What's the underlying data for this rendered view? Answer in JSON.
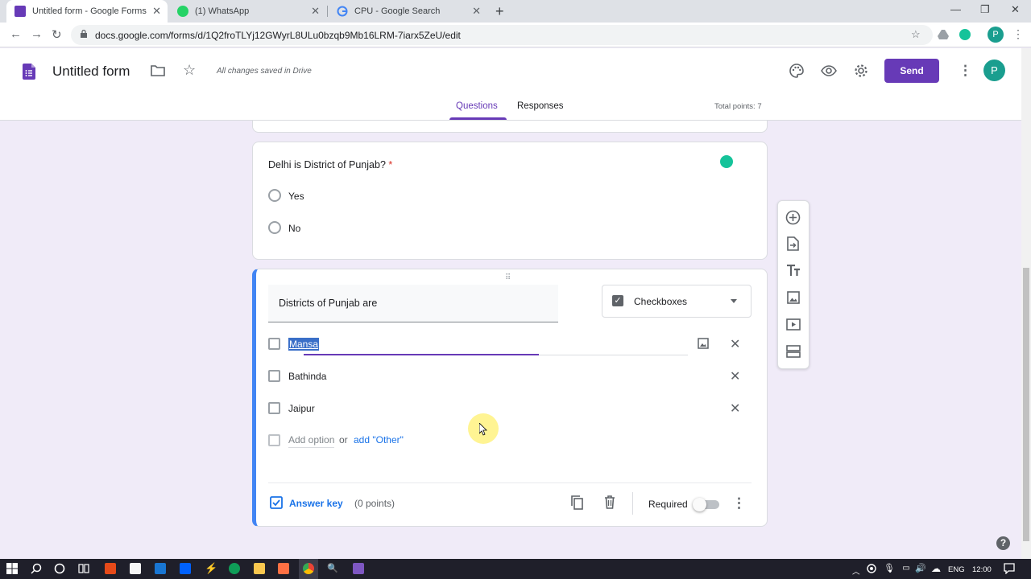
{
  "browser": {
    "tabs": [
      {
        "title": "Untitled form - Google Forms",
        "favicon_color": "#673ab7"
      },
      {
        "title": "(1) WhatsApp",
        "favicon_color": "#25d366"
      },
      {
        "title": "CPU - Google Search",
        "favicon_color": "#4285f4"
      }
    ],
    "url": "docs.google.com/forms/d/1Q2froTLYj12GWyrL8ULu0bzqb9Mb16LRM-7iarx5ZeU/edit",
    "profile_initial": "P"
  },
  "header": {
    "form_title": "Untitled form",
    "save_status": "All changes saved in Drive",
    "send_label": "Send",
    "profile_initial": "P",
    "tabs": [
      "Questions",
      "Responses"
    ],
    "active_tab": "Questions",
    "total_points": "Total points: 7"
  },
  "question1": {
    "title": "Delhi is District of Punjab?",
    "required_mark": "*",
    "options": [
      "Yes",
      "No"
    ]
  },
  "question2": {
    "title": "Districts of Punjab are",
    "type": "Checkboxes",
    "options": [
      "Mansa",
      "Bathinda",
      "Jaipur"
    ],
    "add_option": "Add option",
    "or": "or",
    "add_other": "add \"Other\"",
    "answer_key": "Answer key",
    "points": "(0 points)",
    "required_label": "Required",
    "required": false
  },
  "taskbar": {
    "lang": "ENG",
    "time": "12:00"
  },
  "colors": {
    "accent": "#673ab7",
    "background": "#f0ebf8",
    "active_card": "#4285f4",
    "link": "#1a73e8"
  }
}
